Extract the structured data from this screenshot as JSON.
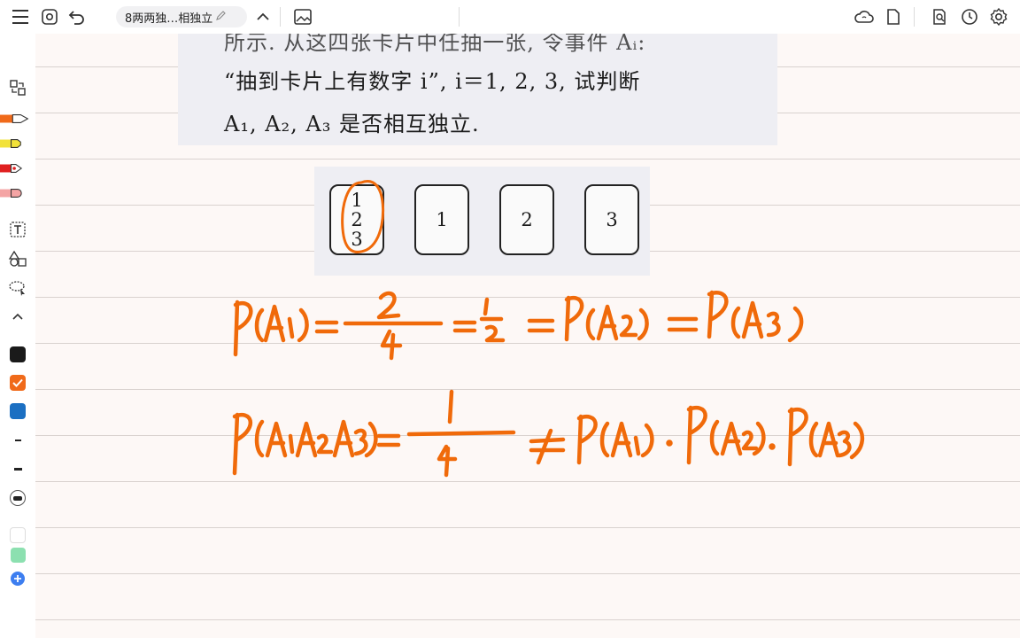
{
  "toolbar": {
    "doc_title": "8两两独…相独立",
    "icons": [
      "menu-icon",
      "settings-view-icon",
      "undo-icon",
      "edit-pencil-icon",
      "chevron-up-icon",
      "image-icon",
      "cloud-sync-icon",
      "page-icon",
      "search-doc-icon",
      "history-clock-icon",
      "gear-icon"
    ]
  },
  "sidebar": {
    "tools": [
      "lasso-select-icon",
      "orange-pen-icon",
      "yellow-highlighter-icon",
      "red-pen-icon",
      "eraser-icon",
      "text-tool-icon",
      "shapes-icon",
      "lasso-icon",
      "collapse-chevron-icon"
    ],
    "colors": {
      "black": "#1a1a1a",
      "orange": "#f06a1a",
      "blue": "#1b6fc2",
      "white": "#ffffff",
      "green": "#8ce0b0",
      "add": "#3d7ef0"
    },
    "selected_color": "orange"
  },
  "textbook": {
    "line1": "所示. 从这四张卡片中任抽一张, 令事件 Aᵢ:",
    "line2": "“抽到卡片上有数字 i”, i＝1, 2, 3, 试判断",
    "line3": "A₁, A₂, A₃ 是否相互独立."
  },
  "cards": {
    "card1": [
      "1",
      "2",
      "3"
    ],
    "card2": "1",
    "card3": "2",
    "card4": "3"
  },
  "ink": {
    "color": "#f06a0a",
    "equation1": "P(A₁)=2/4=1/2=P(A₂)=P(A₃)",
    "equation2": "P(A₁A₂A₃)=1/4≠P(A₁)·P(A₂)·P(A₃)"
  }
}
